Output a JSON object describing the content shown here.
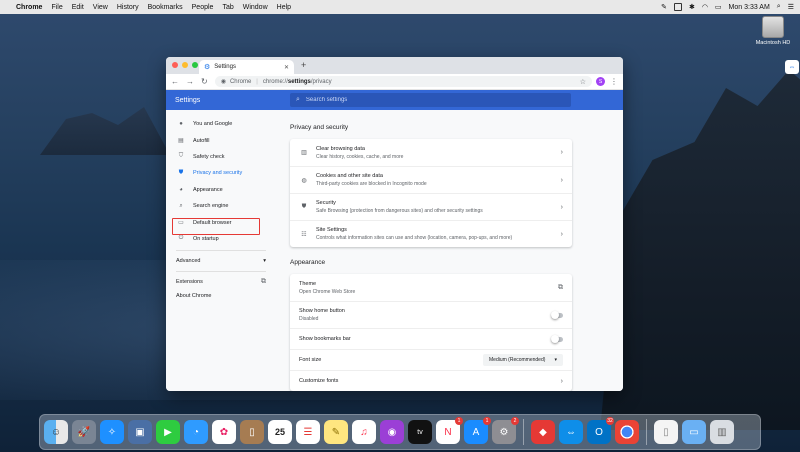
{
  "menubar": {
    "app": "Chrome",
    "items": [
      "File",
      "Edit",
      "View",
      "History",
      "Bookmarks",
      "People",
      "Tab",
      "Window",
      "Help"
    ],
    "clock": "Mon 3:33 AM"
  },
  "desktop": {
    "disk_label": "Macintosh HD"
  },
  "browser": {
    "tab_title": "Settings",
    "omnibox": {
      "site_label": "Chrome",
      "url_prefix": "chrome://",
      "url_bold": "settings",
      "url_suffix": "/privacy"
    },
    "avatar_letter": "S"
  },
  "settings": {
    "header_title": "Settings",
    "search_placeholder": "Search settings",
    "sidebar": {
      "items": [
        {
          "label": "You and Google",
          "icon": "person-icon"
        },
        {
          "label": "Autofill",
          "icon": "clipboard-icon"
        },
        {
          "label": "Safety check",
          "icon": "shield-check-icon"
        },
        {
          "label": "Privacy and security",
          "icon": "shield-icon",
          "active": true
        },
        {
          "label": "Appearance",
          "icon": "palette-icon"
        },
        {
          "label": "Search engine",
          "icon": "search-icon"
        },
        {
          "label": "Default browser",
          "icon": "browser-icon"
        },
        {
          "label": "On startup",
          "icon": "power-icon"
        }
      ],
      "advanced": "Advanced",
      "extensions": "Extensions",
      "about": "About Chrome"
    },
    "privacy": {
      "title": "Privacy and security",
      "rows": [
        {
          "title": "Clear browsing data",
          "subtitle": "Clear history, cookies, cache, and more"
        },
        {
          "title": "Cookies and other site data",
          "subtitle": "Third-party cookies are blocked in Incognito mode"
        },
        {
          "title": "Security",
          "subtitle": "Safe Browsing (protection from dangerous sites) and other security settings"
        },
        {
          "title": "Site Settings",
          "subtitle": "Controls what information sites can use and show (location, camera, pop-ups, and more)"
        }
      ]
    },
    "appearance": {
      "title": "Appearance",
      "theme_title": "Theme",
      "theme_subtitle": "Open Chrome Web Store",
      "home_title": "Show home button",
      "home_subtitle": "Disabled",
      "bookmarks_title": "Show bookmarks bar",
      "font_size_label": "Font size",
      "font_size_value": "Medium (Recommended)",
      "customize_fonts": "Customize fonts"
    }
  },
  "dock": {
    "badges": {
      "news": "1",
      "appstore": "1",
      "prefs": "2",
      "outlook": "32"
    },
    "calendar_day": "25",
    "tv_label": "tv"
  }
}
